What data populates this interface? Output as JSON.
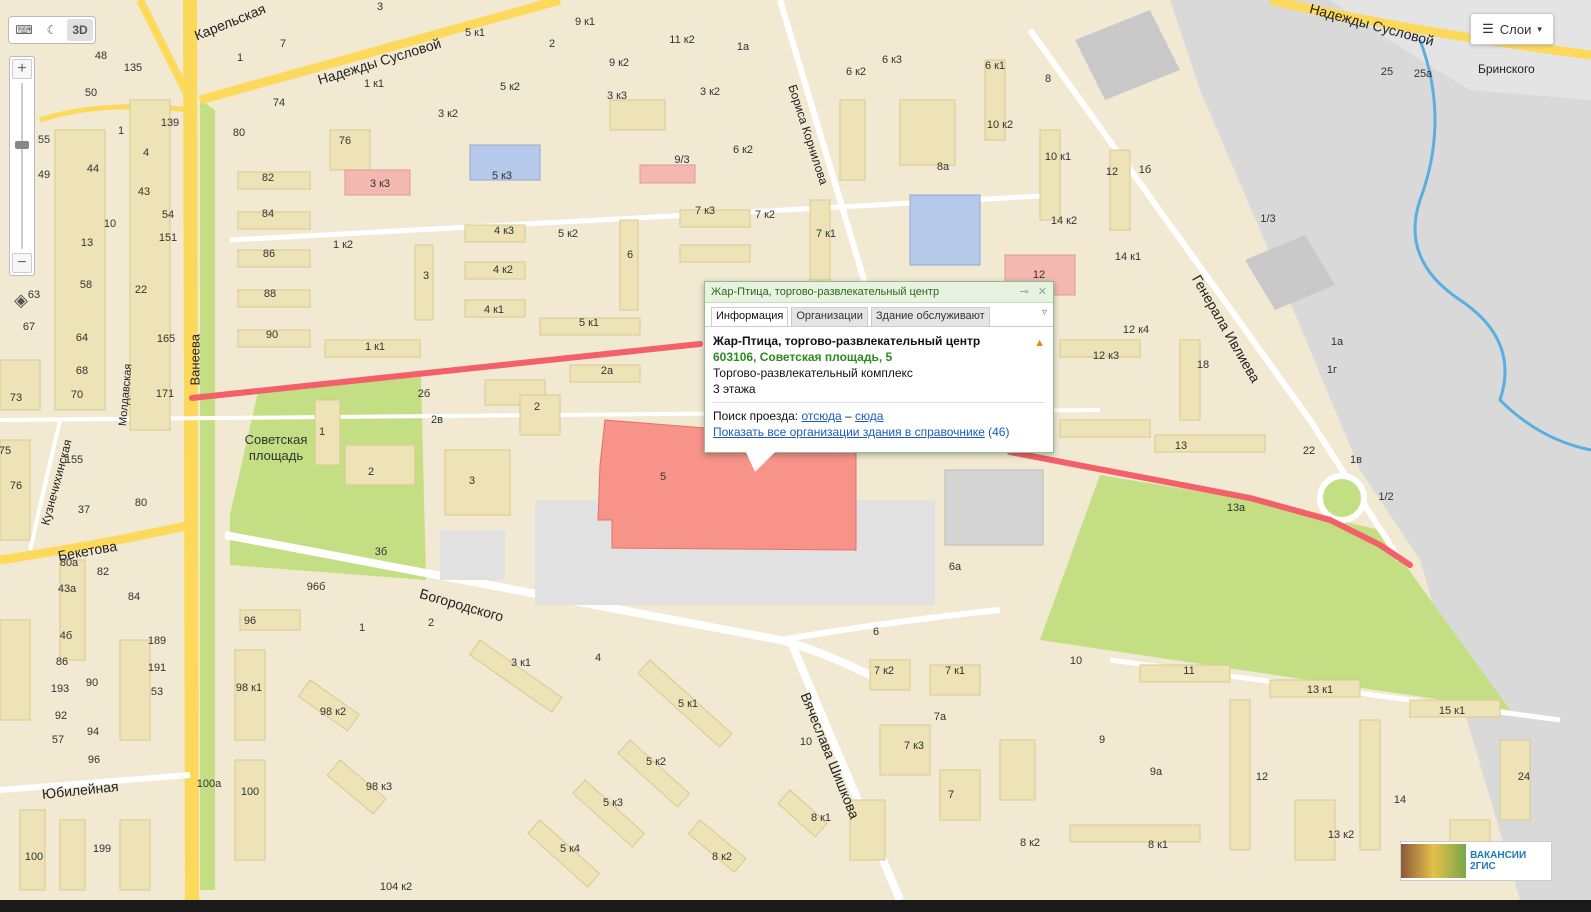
{
  "controls": {
    "keyboard_icon": "keyboard-icon",
    "night_icon": "moon-icon",
    "mode_3d": "3D"
  },
  "layers": {
    "label": "Слои"
  },
  "streets": {
    "karelskaya": "Карельская",
    "nadezhdy_suslovoy": "Надежды Сусловой",
    "nadezhdy_suslovoy_right": "Надежды Сусловой",
    "brinskogo": "Бринского",
    "vaneeva": "Ванеева",
    "kuznechikhinskaya": "Кузнечихинская",
    "moldavskaya": "Молдавская",
    "beketova": "Бекетова",
    "bogorodskogo": "Богородского",
    "vyacheslava_shishkova": "Вячеслава Шишкова",
    "yubileynaya": "Юбилейная",
    "borisa_kornilova": "Бориса Корнилова",
    "generala_ivlieva": "Генерала Ивлиева"
  },
  "areas": {
    "sovetskaya_ploshchad": "Советская площадь"
  },
  "house_labels": [
    "9 к1",
    "11 к2",
    "5 к1",
    "2",
    "1",
    "3",
    "7",
    "48",
    "135",
    "50",
    "1 к1",
    "5 к2",
    "9 к2",
    "3 к3",
    "3 к2",
    "3 к2",
    "74",
    "80",
    "76",
    "82",
    "84",
    "86",
    "88",
    "90",
    "1 к2",
    "4 к3",
    "5 к2",
    "4 к2",
    "4 к1",
    "5 к1",
    "1 к1",
    "3",
    "6",
    "5 к3",
    "3 к3",
    "9/3",
    "7 к3",
    "7 к2",
    "7 к1",
    "1а",
    "6 к2",
    "6 к3",
    "6 к2",
    "6 к1",
    "8",
    "8а",
    "10 к2",
    "10 к1",
    "12",
    "14 к2",
    "14 к1",
    "12 к4",
    "12 к3",
    "18",
    "13",
    "22",
    "13а",
    "1б",
    "1/3",
    "1а",
    "1г",
    "1в",
    "1/2",
    "25",
    "25а",
    "10",
    "12",
    "2б",
    "2а",
    "2в",
    "2",
    "3",
    "1",
    "2",
    "3б",
    "96б",
    "96",
    "2",
    "1",
    "3 к1",
    "4",
    "5 к1",
    "5 к2",
    "5 к3",
    "5 к4",
    "6",
    "7 к2",
    "7 к1",
    "7а",
    "7 к3",
    "7",
    "10",
    "8 к1",
    "8 к2",
    "8 к2",
    "8 к1",
    "9",
    "9а",
    "11",
    "13 к1",
    "15 к1",
    "12",
    "14",
    "13 к2",
    "24",
    "98 к1",
    "98 к2",
    "98 к3",
    "100",
    "100а",
    "104 к2",
    "199",
    "100",
    "5",
    "6а",
    "63",
    "67",
    "64",
    "68",
    "70",
    "73",
    "58",
    "22",
    "165",
    "171",
    "139",
    "1",
    "44",
    "4",
    "49",
    "43",
    "10",
    "54",
    "13",
    "151",
    "155",
    "76",
    "75",
    "37",
    "80",
    "80а",
    "82",
    "43а",
    "84",
    "4б",
    "189",
    "86",
    "191",
    "90",
    "53",
    "193",
    "92",
    "94",
    "57",
    "96",
    "55",
    "49"
  ],
  "popup": {
    "header_title": "Жар-Птица, торгово-развлекательный центр",
    "tabs": [
      "Информация",
      "Организации",
      "Здание обслуживают"
    ],
    "name": "Жар-Птица, торгово-развлекательный центр",
    "address": "603106, Советская площадь, 5",
    "type": "Торгово-развлекательный комплекс",
    "floors": "3 этажа",
    "route_prefix": "Поиск проезда:",
    "route_from": "отсюда",
    "route_dash": "–",
    "route_to": "сюда",
    "show_all": "Показать все организации здания в справочнике",
    "show_all_count": "(46)"
  },
  "promo": {
    "label": "ВАКАНСИИ 2ГИС"
  },
  "colors": {
    "background": "#f1e9d2",
    "building": "#eee3b6",
    "park": "#c4de84",
    "route": "#f4606a",
    "main_road": "#fcd95a",
    "highlight_building": "#f79389",
    "water": "#5aaee0",
    "industrial": "#d5d5d5"
  }
}
